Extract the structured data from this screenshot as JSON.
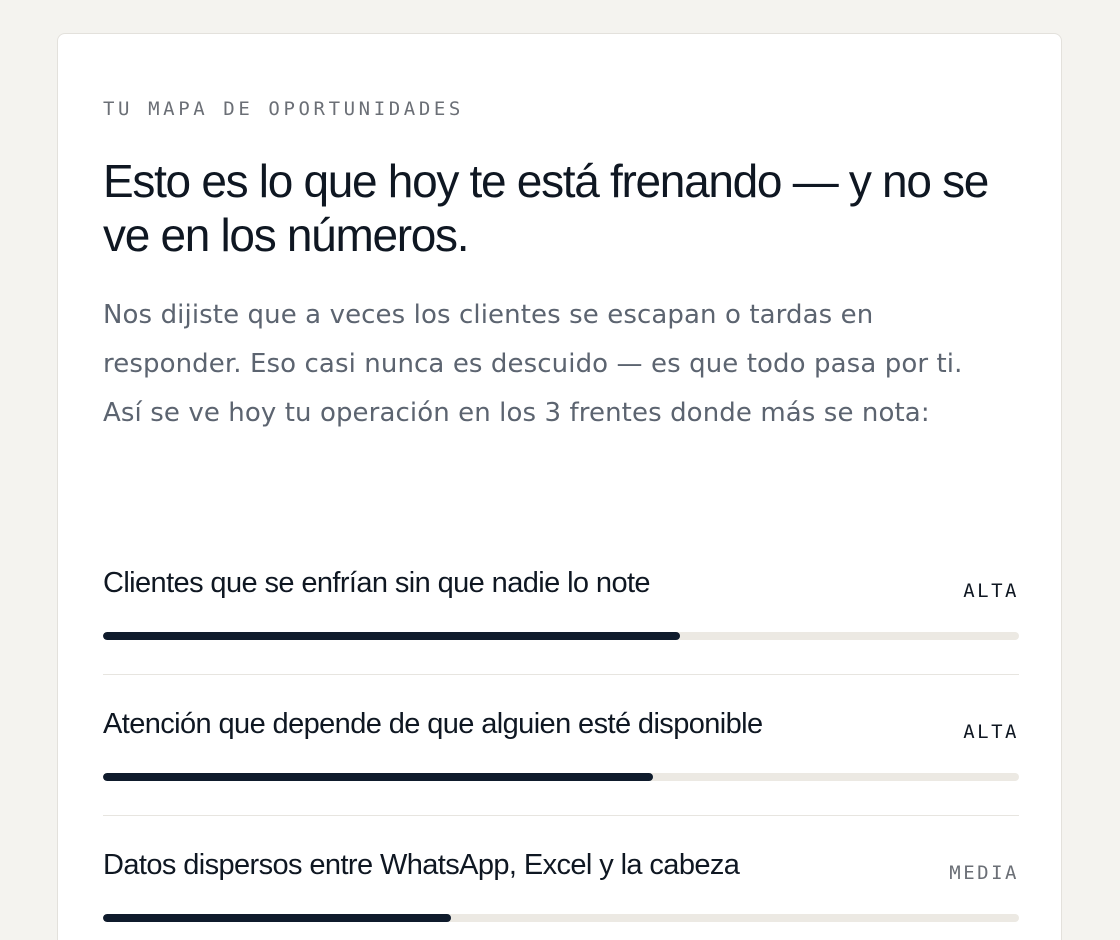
{
  "eyebrow": "TU MAPA DE OPORTUNIDADES",
  "title": "Esto es lo que hoy te está frenando — y no se ve en los números.",
  "intro": "Nos dijiste que a veces los clientes se escapan o tardas en responder. Eso casi nunca es descuido — es que todo pasa por ti. Así se ve hoy tu operación en los 3 frentes donde más se nota:",
  "colors": {
    "accent": "#0f1b2c",
    "track": "#ece9e3",
    "level_high": "#0f1722",
    "level_medium": "#6b6f76"
  },
  "fronts": [
    {
      "label": "Clientes que se enfrían sin que nadie lo note",
      "level": "ALTA",
      "fill": 0.63
    },
    {
      "label": "Atención que depende de que alguien esté disponible",
      "level": "ALTA",
      "fill": 0.6
    },
    {
      "label": "Datos dispersos entre WhatsApp, Excel y la cabeza",
      "level": "MEDIA",
      "fill": 0.38
    }
  ]
}
